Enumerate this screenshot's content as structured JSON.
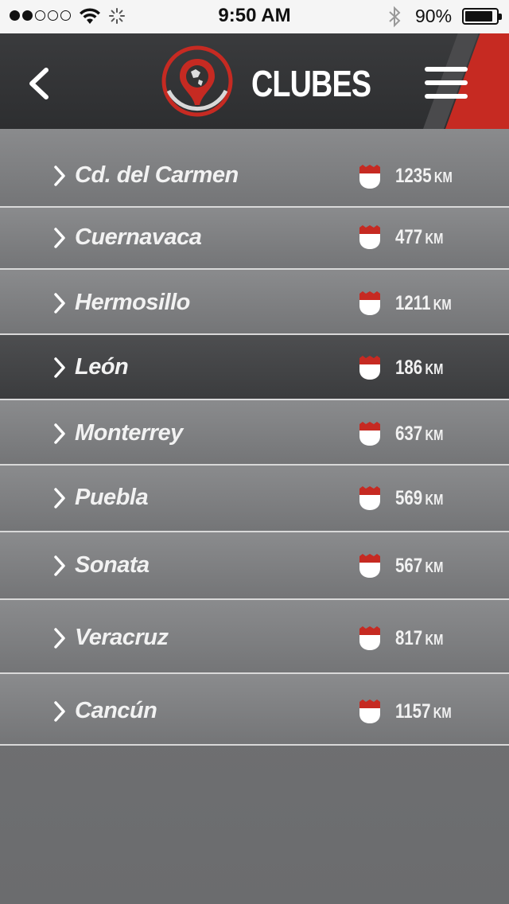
{
  "status_bar": {
    "time": "9:50 AM",
    "battery": "90%",
    "battery_level": 0.9,
    "signal_bars_filled": 2,
    "signal_bars_total": 5
  },
  "header": {
    "title": "CLUBES",
    "back_icon": "chevron-left-icon",
    "menu_icon": "hamburger-menu-icon",
    "logo_icon": "globe-map-pin-icon",
    "accent_color": "#c62a22"
  },
  "clubs": [
    {
      "name": "Cd. del Carmen",
      "distance": "1235",
      "unit": "KM",
      "selected": false
    },
    {
      "name": "Cuernavaca",
      "distance": "477",
      "unit": "KM",
      "selected": false
    },
    {
      "name": "Hermosillo",
      "distance": "1211",
      "unit": "KM",
      "selected": false
    },
    {
      "name": "León",
      "distance": "186",
      "unit": "KM",
      "selected": true
    },
    {
      "name": "Monterrey",
      "distance": "637",
      "unit": "KM",
      "selected": false
    },
    {
      "name": "Puebla",
      "distance": "569",
      "unit": "KM",
      "selected": false
    },
    {
      "name": "Sonata",
      "distance": "567",
      "unit": "KM",
      "selected": false
    },
    {
      "name": "Veracruz",
      "distance": "817",
      "unit": "KM",
      "selected": false
    },
    {
      "name": "Cancún",
      "distance": "1157",
      "unit": "KM",
      "selected": false
    }
  ]
}
